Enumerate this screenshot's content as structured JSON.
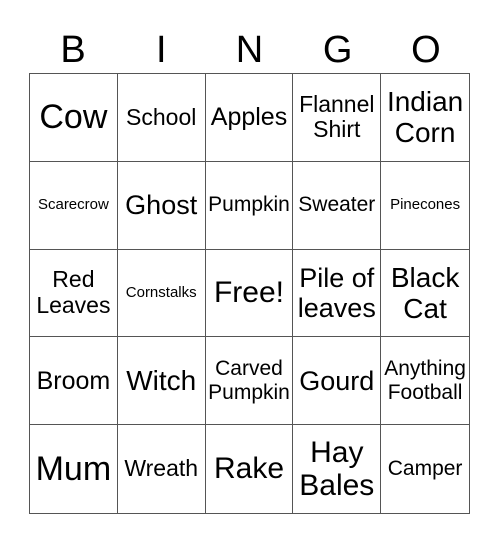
{
  "header": [
    "B",
    "I",
    "N",
    "G",
    "O"
  ],
  "cells": [
    "Cow",
    "School",
    "Apples",
    "Flannel Shirt",
    "Indian Corn",
    "Scarecrow",
    "Ghost",
    "Pumpkin",
    "Sweater",
    "Pinecones",
    "Red Leaves",
    "Cornstalks",
    "Free!",
    "Pile of leaves",
    "Black Cat",
    "Broom",
    "Witch",
    "Carved Pumpkin",
    "Gourd",
    "Anything Football",
    "Mum",
    "Wreath",
    "Rake",
    "Hay Bales",
    "Camper"
  ]
}
